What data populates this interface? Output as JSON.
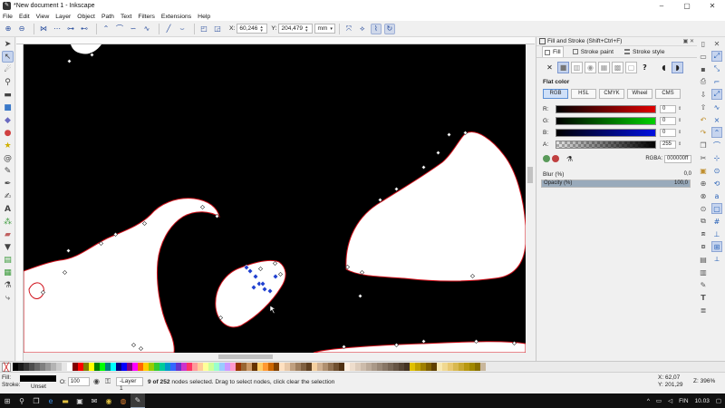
{
  "window": {
    "title": "*New document 1 - Inkscape",
    "icon": "inkscape-icon",
    "controls": [
      "minimize-icon",
      "maximize-icon",
      "close-icon"
    ]
  },
  "menu": [
    "File",
    "Edit",
    "View",
    "Layer",
    "Object",
    "Path",
    "Text",
    "Filters",
    "Extensions",
    "Help"
  ],
  "tool_controls": {
    "x_label": "X:",
    "x_value": "60,246",
    "y_label": "Y:",
    "y_value": "204,479",
    "unit": "mm"
  },
  "toolbox": {
    "active_tool": "node-tool",
    "tools": [
      "selector-tool",
      "node-tool",
      "tweak-tool",
      "zoom-tool",
      "measure-tool",
      "rectangle-tool",
      "3d-box-tool",
      "ellipse-tool",
      "star-tool",
      "spiral-tool",
      "pencil-tool",
      "pen-tool",
      "calligraphy-tool",
      "text-tool",
      "spray-tool",
      "eraser-tool",
      "paint-bucket-tool",
      "gradient-tool",
      "mesh-tool",
      "dropper-tool",
      "connector-tool"
    ]
  },
  "canvas": {
    "selected_shape_outline": "#d0101a",
    "background": "#000000",
    "shape_fill": "#ffffff"
  },
  "fill_stroke": {
    "panel_title": "Fill and Stroke (Shift+Ctrl+F)",
    "tabs": [
      "Fill",
      "Stroke paint",
      "Stroke style"
    ],
    "active_tab": "Fill",
    "unknown_symbol": "?",
    "flat_color_label": "Flat color",
    "modes": [
      "RGB",
      "HSL",
      "CMYK",
      "Wheel",
      "CMS"
    ],
    "active_mode": "RGB",
    "channels": [
      {
        "label": "R:",
        "value": "0",
        "color": "#e00000"
      },
      {
        "label": "G:",
        "value": "0",
        "color": "#00d000"
      },
      {
        "label": "B:",
        "value": "0",
        "color": "#0010e0"
      },
      {
        "label": "A:",
        "value": "255",
        "color": "#000000"
      }
    ],
    "rgba_label": "RGBA:",
    "rgba_value": "000000ff",
    "blur_label": "Blur (%)",
    "blur_value": "0,0",
    "opacity_label": "Opacity (%)",
    "opacity_value": "100,0",
    "opacity_fraction": 1.0
  },
  "statusbar": {
    "fill_label": "Fill:",
    "stroke_label": "Stroke:",
    "stroke_value": "Unset",
    "opacity_label": "O:",
    "opacity_value": "100",
    "layer": "-Layer 1",
    "message_bold": "9 of 252",
    "message_rest": " nodes selected. Drag to select nodes, click clear the selection",
    "x_label": "X:",
    "x_value": "62,07",
    "y_label": "Y:",
    "y_value": "201,29",
    "zoom_label": "Z:",
    "zoom_value": "396%"
  },
  "taskbar": {
    "apps": [
      "windows-start-icon",
      "search-icon",
      "task-view-icon",
      "edge-icon",
      "explorer-icon",
      "store-icon",
      "mail-icon",
      "chrome-icon",
      "firefox-icon",
      "inkscape-icon"
    ],
    "lang": "FIN",
    "time": "10.03"
  },
  "palette": [
    "#000000",
    "#1a1a1a",
    "#333333",
    "#4d4d4d",
    "#666666",
    "#808080",
    "#999999",
    "#b3b3b3",
    "#cccccc",
    "#e6e6e6",
    "#ffffff",
    "#800000",
    "#ff0000",
    "#808000",
    "#ffff00",
    "#008000",
    "#00ff00",
    "#008080",
    "#00ffff",
    "#000080",
    "#0000ff",
    "#800080",
    "#ff00ff",
    "#ff6600",
    "#ffcc00",
    "#99cc00",
    "#33cc33",
    "#00cc99",
    "#0099cc",
    "#3366ff",
    "#6633cc",
    "#cc33cc",
    "#ff3366",
    "#ff9999",
    "#ffcc99",
    "#ffff99",
    "#ccff99",
    "#99ffcc",
    "#99ccff",
    "#cc99ff",
    "#ff99cc",
    "#993300",
    "#996633",
    "#cc9966",
    "#663300",
    "#ffcc66",
    "#ff9933",
    "#cc6600",
    "#804000",
    "#ffe0c0",
    "#e8c8a8",
    "#c0a080",
    "#a08060",
    "#806040",
    "#604020",
    "#f4d0a0",
    "#d0b090",
    "#b09070",
    "#907050",
    "#705030",
    "#503010",
    "#ffeedd",
    "#eeddcc",
    "#ddccbb",
    "#ccbbaa",
    "#bbaa99",
    "#aa9988",
    "#998877",
    "#887766",
    "#776655",
    "#665544",
    "#554433",
    "#443322",
    "#e0c000",
    "#c0a000",
    "#a08000",
    "#806000",
    "#604000",
    "#f8e8b0",
    "#f0d890",
    "#e8c870",
    "#d8b850",
    "#c8a830",
    "#b89810",
    "#a08800",
    "#887000",
    "#c9b79c"
  ]
}
